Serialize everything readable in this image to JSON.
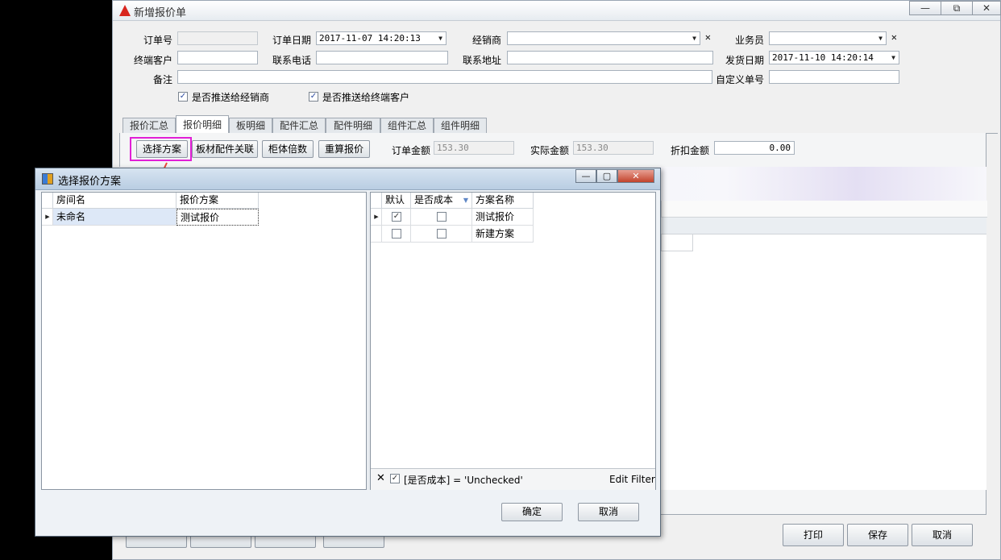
{
  "main_window": {
    "title": "新增报价单",
    "labels": {
      "order_no": "订单号",
      "order_date": "订单日期",
      "dealer": "经销商",
      "salesman": "业务员",
      "end_customer": "终端客户",
      "phone": "联系电话",
      "address": "联系地址",
      "ship_date": "发货日期",
      "remark": "备注",
      "custom_no": "自定义单号"
    },
    "values": {
      "order_date": "2017-11-07  14:20:13",
      "ship_date": "2017-11-10  14:20:14"
    },
    "checkboxes": {
      "push_dealer": "是否推送给经销商",
      "push_end_customer": "是否推送给终端客户"
    },
    "tabs": [
      "报价汇总",
      "报价明细",
      "板明细",
      "配件汇总",
      "配件明细",
      "组件汇总",
      "组件明细"
    ],
    "toolbar": {
      "select_plan": "选择方案",
      "board_accessory": "板材配件关联",
      "cabinet_multiple": "柜体倍数",
      "recalc": "重算报价",
      "order_amount_label": "订单金额",
      "order_amount": "153.30",
      "actual_amount_label": "实际金额",
      "actual_amount": "153.30",
      "discount_label": "折扣金额",
      "discount_amount": "0.00"
    },
    "bottom_buttons": {
      "print": "打印",
      "save": "保存",
      "cancel": "取消"
    }
  },
  "dialog": {
    "title": "选择报价方案",
    "left_grid": {
      "headers": [
        "房间名",
        "报价方案"
      ],
      "rows": [
        [
          "未命名",
          "测试报价"
        ]
      ]
    },
    "right_grid": {
      "headers": [
        "默认",
        "是否成本",
        "方案名称"
      ],
      "rows": [
        {
          "default": true,
          "cost": false,
          "name": "测试报价"
        },
        {
          "default": false,
          "cost": false,
          "name": "新建方案"
        }
      ]
    },
    "filter": {
      "text": "[是否成本] = 'Unchecked'",
      "edit": "Edit Filter"
    },
    "ok": "确定",
    "cancel": "取消"
  },
  "colors": {
    "highlight_border": "#e21fd6",
    "arrow": "#e8443a"
  }
}
